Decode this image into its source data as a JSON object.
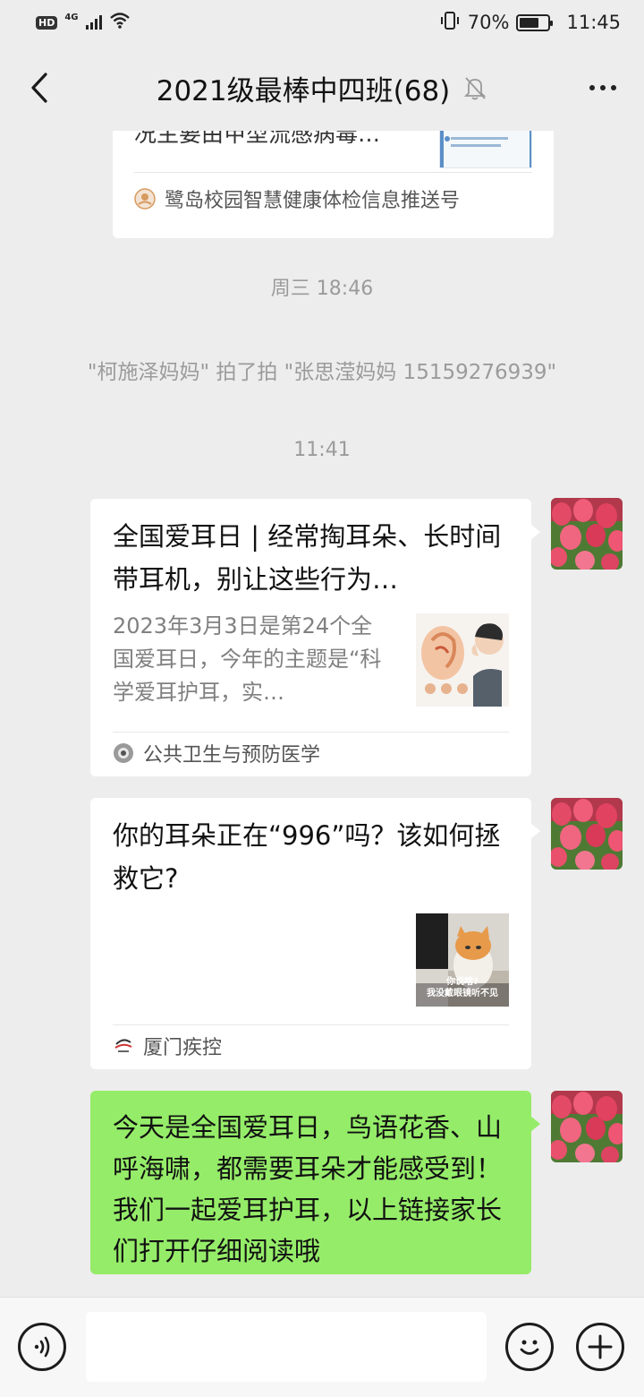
{
  "status_bar": {
    "hd": "HD",
    "network": "4G",
    "battery_level": 0.7,
    "battery_text": "70%",
    "time": "11:45",
    "icons": [
      "signal-icon",
      "wifi-icon",
      "vibrate-icon",
      "battery-icon"
    ]
  },
  "header": {
    "title": "2021级最棒中四班(68)",
    "icons": [
      "back-icon",
      "mute-bell-icon",
      "more-icon"
    ]
  },
  "messages": {
    "top_card": {
      "text_line1": "况主要由甲型流感病毒…",
      "source": "鹭岛校园智慧健康体检信息推送号"
    },
    "timestamp1": "周三 18:46",
    "pat_notice": "\"柯施泽妈妈\" 拍了拍 \"张思滢妈妈 15159276939\"",
    "timestamp2": "11:41",
    "card1": {
      "title": "全国爱耳日 | 经常掏耳朵、长时间带耳机，别让这些行为…",
      "desc": "2023年3月3日是第24个全国爱耳日，今年的主题是“科学爱耳护耳，实…",
      "source": "公共卫生与预防医学"
    },
    "card2": {
      "title": "你的耳朵正在“996”吗？该如何拯救它?",
      "thumb_caption1": "你说啥?",
      "thumb_caption2": "我没戴眼镜听不见",
      "source": "厦门疾控"
    },
    "text_message": "今天是全国爱耳日，鸟语花香、山呼海啸，都需要耳朵才能感受到！我们一起爱耳护耳，以上链接家长们打开仔细阅读哦"
  },
  "input_bar": {
    "icons": [
      "voice-icon",
      "emoji-icon",
      "plus-icon"
    ]
  },
  "colors": {
    "background": "#ededed",
    "bubble_self": "#95ec69",
    "bubble_card": "#ffffff",
    "system_text": "#9b9b9b"
  }
}
